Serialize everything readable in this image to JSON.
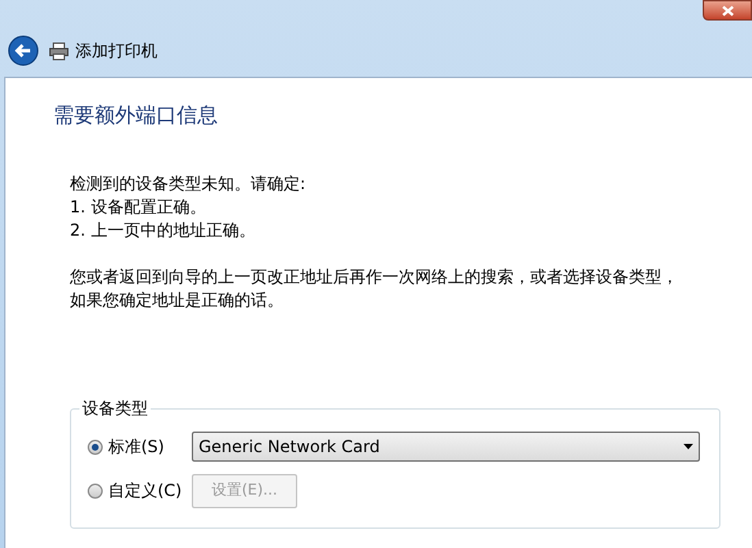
{
  "window": {
    "title": "添加打印机"
  },
  "heading": "需要额外端口信息",
  "intro": [
    "检测到的设备类型未知。请确定:",
    "1. 设备配置正确。",
    "2. 上一页中的地址正确。"
  ],
  "paragraph": "您或者返回到向导的上一页改正地址后再作一次网络上的搜索，或者选择设备类型，如果您确定地址是正确的话。",
  "device_type": {
    "legend": "设备类型",
    "options": [
      {
        "label": "标准(S)",
        "selected": true,
        "kind": "dropdown",
        "value": "Generic Network Card"
      },
      {
        "label": "自定义(C)",
        "selected": false,
        "kind": "button",
        "button": "设置(E)...",
        "disabled": true
      }
    ]
  }
}
